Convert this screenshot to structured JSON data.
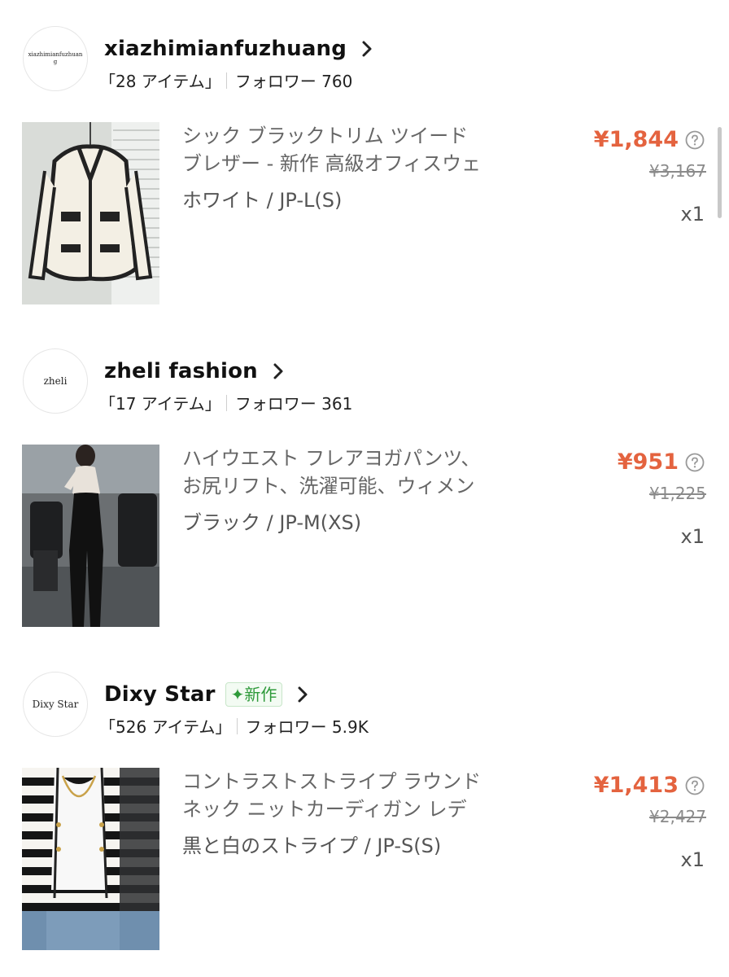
{
  "stores": [
    {
      "avatar_text": "xiazhimianfuzhuang",
      "name": "xiazhimianfuzhuang",
      "badge": "",
      "items_count": "「28 アイテム」",
      "followers": "フォロワー 760",
      "product": {
        "title_line1": "シック ブラックトリム ツイード",
        "title_line2": "ブレザー - 新作 高級オフィスウェ",
        "variant": "ホワイト / JP-L(S)",
        "price": "¥1,844",
        "original_price": "¥3,167",
        "quantity": "x1",
        "image": "white-tweed-blazer"
      }
    },
    {
      "avatar_text": "zheli",
      "name": "zheli fashion",
      "badge": "",
      "items_count": "「17 アイテム」",
      "followers": "フォロワー 361",
      "product": {
        "title_line1": "ハイウエスト フレアヨガパンツ、",
        "title_line2": "お尻リフト、洗濯可能、ウィメン",
        "variant": "ブラック / JP-M(XS)",
        "price": "¥951",
        "original_price": "¥1,225",
        "quantity": "x1",
        "image": "black-flare-yoga-pants"
      }
    },
    {
      "avatar_text": "Dixy Star",
      "name": "Dixy Star",
      "badge": "✦新作",
      "items_count": "「526 アイテム」",
      "followers": "フォロワー 5.9K",
      "product": {
        "title_line1": "コントラストストライプ ラウンド",
        "title_line2": "ネック ニットカーディガン レデ",
        "variant": "黒と白のストライプ / JP-S(S)",
        "price": "¥1,413",
        "original_price": "¥2,427",
        "quantity": "x1",
        "image": "striped-knit-cardigan"
      }
    }
  ],
  "colors": {
    "price": "#e4633f",
    "badge": "#2e9a3a",
    "muted": "#8a8a8a"
  },
  "icons": {
    "chevron": "chevron-right-icon",
    "help": "question-circle-icon"
  }
}
